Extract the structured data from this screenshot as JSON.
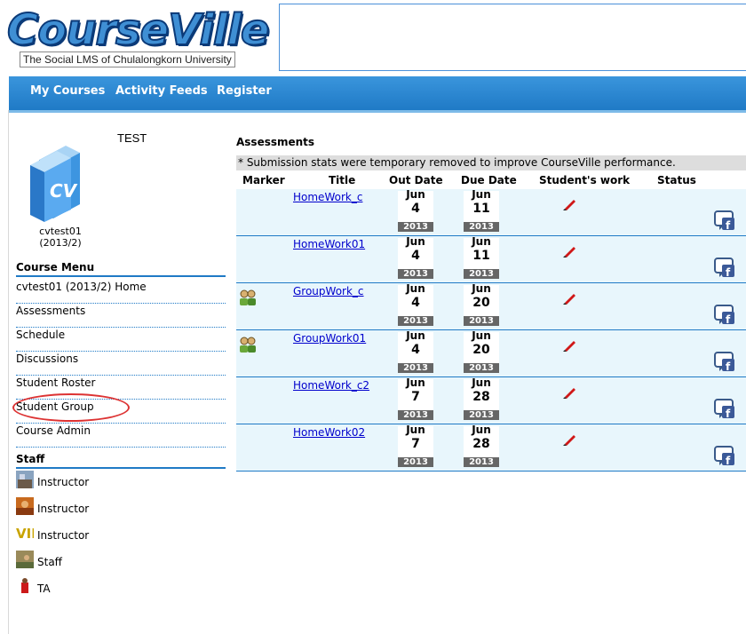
{
  "logo": {
    "word": "CourseVille",
    "tagline": "The Social LMS of Chulalongkorn University"
  },
  "nav": {
    "items": [
      "My Courses",
      "Activity Feeds",
      "Register"
    ]
  },
  "course": {
    "name": "TEST",
    "code": "cvtest01",
    "term": "(2013/2)"
  },
  "course_menu": {
    "heading": "Course Menu",
    "items": [
      "cvtest01 (2013/2) Home",
      "Assessments",
      "Schedule",
      "Discussions",
      "Student Roster",
      "Student Group",
      "Course Admin"
    ]
  },
  "staff": {
    "heading": "Staff",
    "members": [
      "Instructor",
      "Instructor",
      "Instructor",
      "Staff",
      "TA"
    ]
  },
  "assessments": {
    "heading": "Assessments",
    "note": "* Submission stats were temporary removed to improve CourseVille performance.",
    "columns": [
      "Marker",
      "Title",
      "Out Date",
      "Due Date",
      "Student's work",
      "Status"
    ],
    "rows": [
      {
        "title": "HomeWork_c",
        "group": false,
        "out": {
          "m": "Jun",
          "d": "4",
          "y": "2013"
        },
        "due": {
          "m": "Jun",
          "d": "11",
          "y": "2013"
        }
      },
      {
        "title": "HomeWork01",
        "group": false,
        "out": {
          "m": "Jun",
          "d": "4",
          "y": "2013"
        },
        "due": {
          "m": "Jun",
          "d": "11",
          "y": "2013"
        }
      },
      {
        "title": "GroupWork_c",
        "group": true,
        "out": {
          "m": "Jun",
          "d": "4",
          "y": "2013"
        },
        "due": {
          "m": "Jun",
          "d": "20",
          "y": "2013"
        }
      },
      {
        "title": "GroupWork01",
        "group": true,
        "out": {
          "m": "Jun",
          "d": "4",
          "y": "2013"
        },
        "due": {
          "m": "Jun",
          "d": "20",
          "y": "2013"
        }
      },
      {
        "title": "HomeWork_c2",
        "group": false,
        "out": {
          "m": "Jun",
          "d": "7",
          "y": "2013"
        },
        "due": {
          "m": "Jun",
          "d": "28",
          "y": "2013"
        }
      },
      {
        "title": "HomeWork02",
        "group": false,
        "out": {
          "m": "Jun",
          "d": "7",
          "y": "2013"
        },
        "due": {
          "m": "Jun",
          "d": "28",
          "y": "2013"
        }
      }
    ]
  },
  "icons": {
    "group": "group-marker-icon",
    "pen": "pencil-icon",
    "share": "facebook-share-icon"
  },
  "colors": {
    "brand": "#1f7ac6",
    "row_bg": "#e8f6fc",
    "highlight": "#dd3333"
  }
}
